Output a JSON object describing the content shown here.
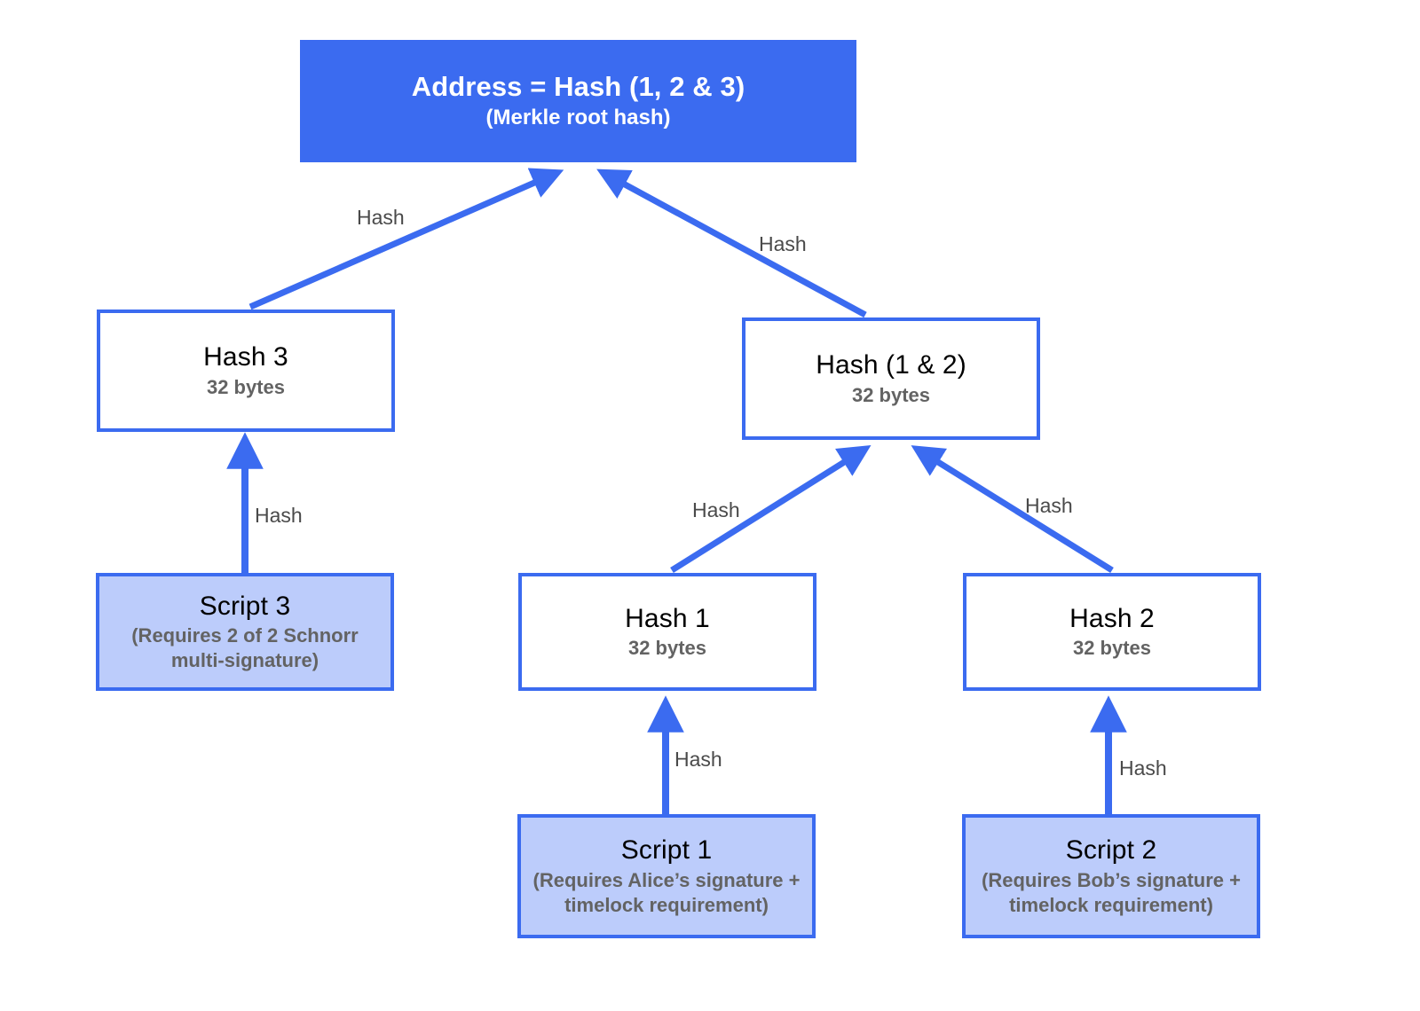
{
  "diagram": {
    "type": "merkle-tree",
    "accent_color": "#3B6BF0",
    "script_fill_color": "#BCCCFB",
    "label_color": "#4a4a4a",
    "subtitle_color": "#636363",
    "nodes": [
      {
        "id": "root",
        "title": "Address = Hash (1, 2 & 3)",
        "subtitle": "(Merkle root hash)",
        "style": "root"
      },
      {
        "id": "hash3",
        "title": "Hash 3",
        "subtitle": "32 bytes",
        "style": "hash"
      },
      {
        "id": "hash12",
        "title": "Hash (1 & 2)",
        "subtitle": "32 bytes",
        "style": "hash"
      },
      {
        "id": "hash1",
        "title": "Hash 1",
        "subtitle": "32 bytes",
        "style": "hash"
      },
      {
        "id": "hash2",
        "title": "Hash 2",
        "subtitle": "32 bytes",
        "style": "hash"
      },
      {
        "id": "script3",
        "title": "Script 3",
        "subtitle": "(Requires 2 of 2 Schnorr multi-signature)",
        "style": "script"
      },
      {
        "id": "script1",
        "title": "Script 1",
        "subtitle": "(Requires Alice’s signature + timelock requirement)",
        "style": "script"
      },
      {
        "id": "script2",
        "title": "Script 2",
        "subtitle": "(Requires Bob’s signature + timelock requirement)",
        "style": "script"
      }
    ],
    "edges": [
      {
        "id": "e-hash3-root",
        "from": "hash3",
        "to": "root",
        "label": "Hash"
      },
      {
        "id": "e-hash12-root",
        "from": "hash12",
        "to": "root",
        "label": "Hash"
      },
      {
        "id": "e-script3-hash3",
        "from": "script3",
        "to": "hash3",
        "label": "Hash"
      },
      {
        "id": "e-hash1-hash12",
        "from": "hash1",
        "to": "hash12",
        "label": "Hash"
      },
      {
        "id": "e-hash2-hash12",
        "from": "hash2",
        "to": "hash12",
        "label": "Hash"
      },
      {
        "id": "e-script1-hash1",
        "from": "script1",
        "to": "hash1",
        "label": "Hash"
      },
      {
        "id": "e-script2-hash2",
        "from": "script2",
        "to": "hash2",
        "label": "Hash"
      }
    ]
  }
}
